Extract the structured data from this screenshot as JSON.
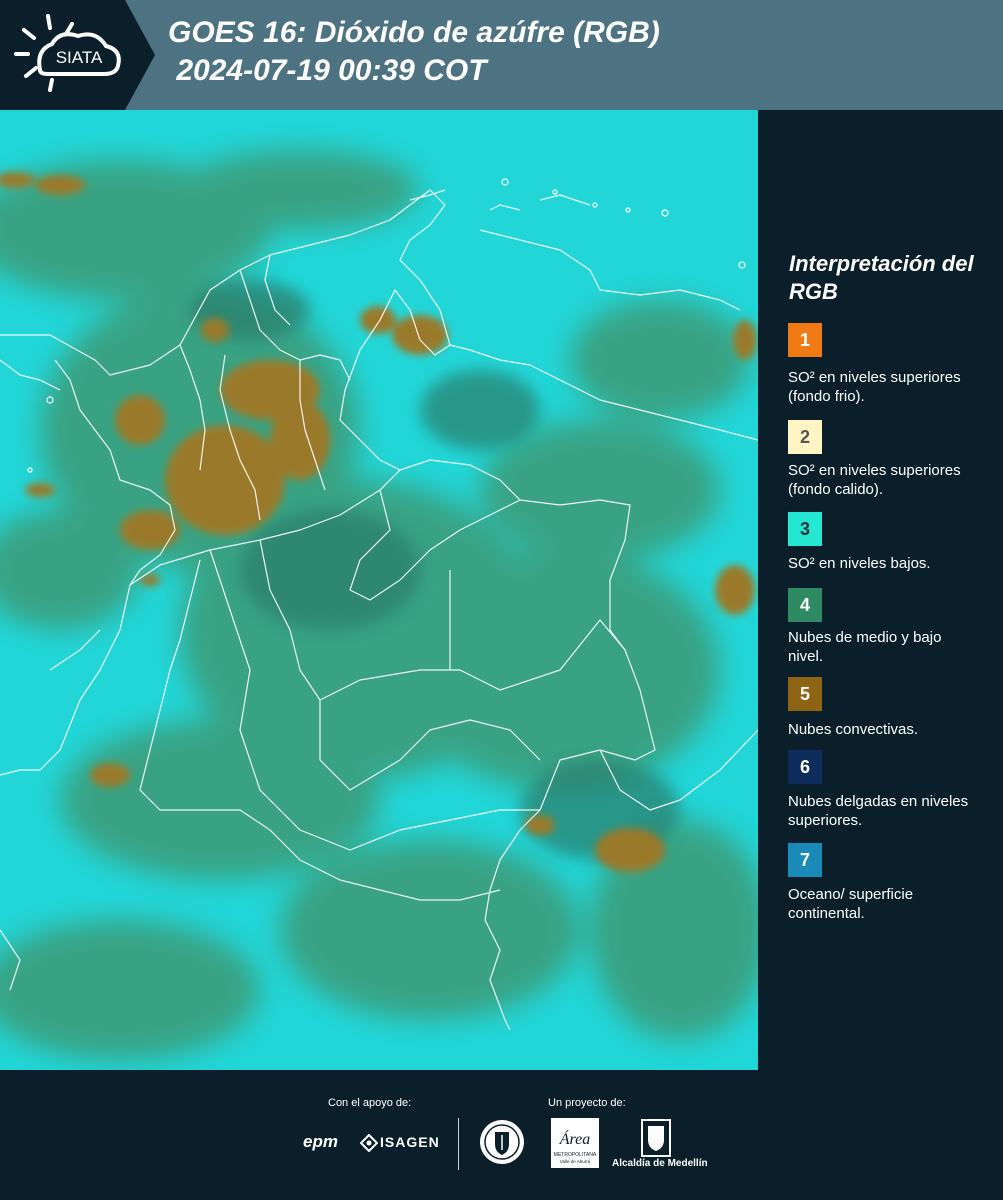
{
  "header": {
    "logo_text": "SIATA",
    "title_line1": "GOES 16: Dióxido de azúfre (RGB)",
    "title_line2": " 2024-07-19 00:39 COT"
  },
  "legend": {
    "title": "Interpretación del RGB",
    "items": [
      {
        "num": "1",
        "color": "#f07a14",
        "label": "SO² en niveles superiores (fondo frio)."
      },
      {
        "num": "2",
        "color": "#fff5c4",
        "label": "SO² en niveles superiores (fondo calido)."
      },
      {
        "num": "3",
        "color": "#24e8d2",
        "label": "SO² en niveles bajos."
      },
      {
        "num": "4",
        "color": "#2e8a62",
        "label": "Nubes de medio y bajo nivel."
      },
      {
        "num": "5",
        "color": "#8c6414",
        "label": "Nubes convectivas."
      },
      {
        "num": "6",
        "color": "#0e2c5c",
        "label": "Nubes delgadas en niveles superiores."
      },
      {
        "num": "7",
        "color": "#1a8ab8",
        "label": "Oceano/ superficie continental."
      }
    ]
  },
  "footer": {
    "support_label": "Con el apoyo de:",
    "project_label": "Un proyecto de:",
    "epm_text": "epm",
    "isagen_text": "ISAGEN",
    "area_text": "Área",
    "area_subtext": "METROPOLITANA",
    "area_subtext2": "Valle de Aburrá",
    "alcaldia_text": "Alcaldía de Medellín"
  },
  "colors": {
    "header_bg": "#4d7382",
    "page_bg": "#0b1f2b",
    "map_cyan": "#18d6d9",
    "map_green": "#2e8a62",
    "map_brown": "#9a7a2c"
  }
}
